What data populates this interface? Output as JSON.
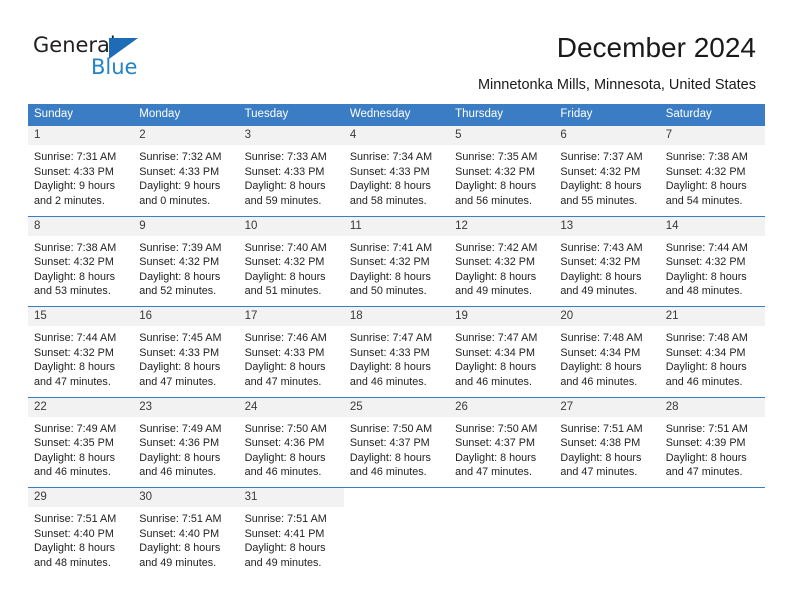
{
  "brand": {
    "name_top": "General",
    "name_bottom": "Blue",
    "triangle_color": "#1e6cb5",
    "blue_text_color": "#2283c6"
  },
  "header": {
    "title": "December 2024",
    "subtitle": "Minnetonka Mills, Minnesota, United States"
  },
  "theme": {
    "header_blue": "#3b7dc4",
    "day_band_gray": "#f2f2f2",
    "cell_white": "#ffffff"
  },
  "calendar": {
    "weekdays": [
      "Sunday",
      "Monday",
      "Tuesday",
      "Wednesday",
      "Thursday",
      "Friday",
      "Saturday"
    ],
    "weeks": [
      [
        {
          "day": "1",
          "lines": [
            "Sunrise: 7:31 AM",
            "Sunset: 4:33 PM",
            "Daylight: 9 hours",
            "and 2 minutes."
          ]
        },
        {
          "day": "2",
          "lines": [
            "Sunrise: 7:32 AM",
            "Sunset: 4:33 PM",
            "Daylight: 9 hours",
            "and 0 minutes."
          ]
        },
        {
          "day": "3",
          "lines": [
            "Sunrise: 7:33 AM",
            "Sunset: 4:33 PM",
            "Daylight: 8 hours",
            "and 59 minutes."
          ]
        },
        {
          "day": "4",
          "lines": [
            "Sunrise: 7:34 AM",
            "Sunset: 4:33 PM",
            "Daylight: 8 hours",
            "and 58 minutes."
          ]
        },
        {
          "day": "5",
          "lines": [
            "Sunrise: 7:35 AM",
            "Sunset: 4:32 PM",
            "Daylight: 8 hours",
            "and 56 minutes."
          ]
        },
        {
          "day": "6",
          "lines": [
            "Sunrise: 7:37 AM",
            "Sunset: 4:32 PM",
            "Daylight: 8 hours",
            "and 55 minutes."
          ]
        },
        {
          "day": "7",
          "lines": [
            "Sunrise: 7:38 AM",
            "Sunset: 4:32 PM",
            "Daylight: 8 hours",
            "and 54 minutes."
          ]
        }
      ],
      [
        {
          "day": "8",
          "lines": [
            "Sunrise: 7:38 AM",
            "Sunset: 4:32 PM",
            "Daylight: 8 hours",
            "and 53 minutes."
          ]
        },
        {
          "day": "9",
          "lines": [
            "Sunrise: 7:39 AM",
            "Sunset: 4:32 PM",
            "Daylight: 8 hours",
            "and 52 minutes."
          ]
        },
        {
          "day": "10",
          "lines": [
            "Sunrise: 7:40 AM",
            "Sunset: 4:32 PM",
            "Daylight: 8 hours",
            "and 51 minutes."
          ]
        },
        {
          "day": "11",
          "lines": [
            "Sunrise: 7:41 AM",
            "Sunset: 4:32 PM",
            "Daylight: 8 hours",
            "and 50 minutes."
          ]
        },
        {
          "day": "12",
          "lines": [
            "Sunrise: 7:42 AM",
            "Sunset: 4:32 PM",
            "Daylight: 8 hours",
            "and 49 minutes."
          ]
        },
        {
          "day": "13",
          "lines": [
            "Sunrise: 7:43 AM",
            "Sunset: 4:32 PM",
            "Daylight: 8 hours",
            "and 49 minutes."
          ]
        },
        {
          "day": "14",
          "lines": [
            "Sunrise: 7:44 AM",
            "Sunset: 4:32 PM",
            "Daylight: 8 hours",
            "and 48 minutes."
          ]
        }
      ],
      [
        {
          "day": "15",
          "lines": [
            "Sunrise: 7:44 AM",
            "Sunset: 4:32 PM",
            "Daylight: 8 hours",
            "and 47 minutes."
          ]
        },
        {
          "day": "16",
          "lines": [
            "Sunrise: 7:45 AM",
            "Sunset: 4:33 PM",
            "Daylight: 8 hours",
            "and 47 minutes."
          ]
        },
        {
          "day": "17",
          "lines": [
            "Sunrise: 7:46 AM",
            "Sunset: 4:33 PM",
            "Daylight: 8 hours",
            "and 47 minutes."
          ]
        },
        {
          "day": "18",
          "lines": [
            "Sunrise: 7:47 AM",
            "Sunset: 4:33 PM",
            "Daylight: 8 hours",
            "and 46 minutes."
          ]
        },
        {
          "day": "19",
          "lines": [
            "Sunrise: 7:47 AM",
            "Sunset: 4:34 PM",
            "Daylight: 8 hours",
            "and 46 minutes."
          ]
        },
        {
          "day": "20",
          "lines": [
            "Sunrise: 7:48 AM",
            "Sunset: 4:34 PM",
            "Daylight: 8 hours",
            "and 46 minutes."
          ]
        },
        {
          "day": "21",
          "lines": [
            "Sunrise: 7:48 AM",
            "Sunset: 4:34 PM",
            "Daylight: 8 hours",
            "and 46 minutes."
          ]
        }
      ],
      [
        {
          "day": "22",
          "lines": [
            "Sunrise: 7:49 AM",
            "Sunset: 4:35 PM",
            "Daylight: 8 hours",
            "and 46 minutes."
          ]
        },
        {
          "day": "23",
          "lines": [
            "Sunrise: 7:49 AM",
            "Sunset: 4:36 PM",
            "Daylight: 8 hours",
            "and 46 minutes."
          ]
        },
        {
          "day": "24",
          "lines": [
            "Sunrise: 7:50 AM",
            "Sunset: 4:36 PM",
            "Daylight: 8 hours",
            "and 46 minutes."
          ]
        },
        {
          "day": "25",
          "lines": [
            "Sunrise: 7:50 AM",
            "Sunset: 4:37 PM",
            "Daylight: 8 hours",
            "and 46 minutes."
          ]
        },
        {
          "day": "26",
          "lines": [
            "Sunrise: 7:50 AM",
            "Sunset: 4:37 PM",
            "Daylight: 8 hours",
            "and 47 minutes."
          ]
        },
        {
          "day": "27",
          "lines": [
            "Sunrise: 7:51 AM",
            "Sunset: 4:38 PM",
            "Daylight: 8 hours",
            "and 47 minutes."
          ]
        },
        {
          "day": "28",
          "lines": [
            "Sunrise: 7:51 AM",
            "Sunset: 4:39 PM",
            "Daylight: 8 hours",
            "and 47 minutes."
          ]
        }
      ],
      [
        {
          "day": "29",
          "lines": [
            "Sunrise: 7:51 AM",
            "Sunset: 4:40 PM",
            "Daylight: 8 hours",
            "and 48 minutes."
          ]
        },
        {
          "day": "30",
          "lines": [
            "Sunrise: 7:51 AM",
            "Sunset: 4:40 PM",
            "Daylight: 8 hours",
            "and 49 minutes."
          ]
        },
        {
          "day": "31",
          "lines": [
            "Sunrise: 7:51 AM",
            "Sunset: 4:41 PM",
            "Daylight: 8 hours",
            "and 49 minutes."
          ]
        },
        {
          "day": "",
          "lines": []
        },
        {
          "day": "",
          "lines": []
        },
        {
          "day": "",
          "lines": []
        },
        {
          "day": "",
          "lines": []
        }
      ]
    ]
  }
}
